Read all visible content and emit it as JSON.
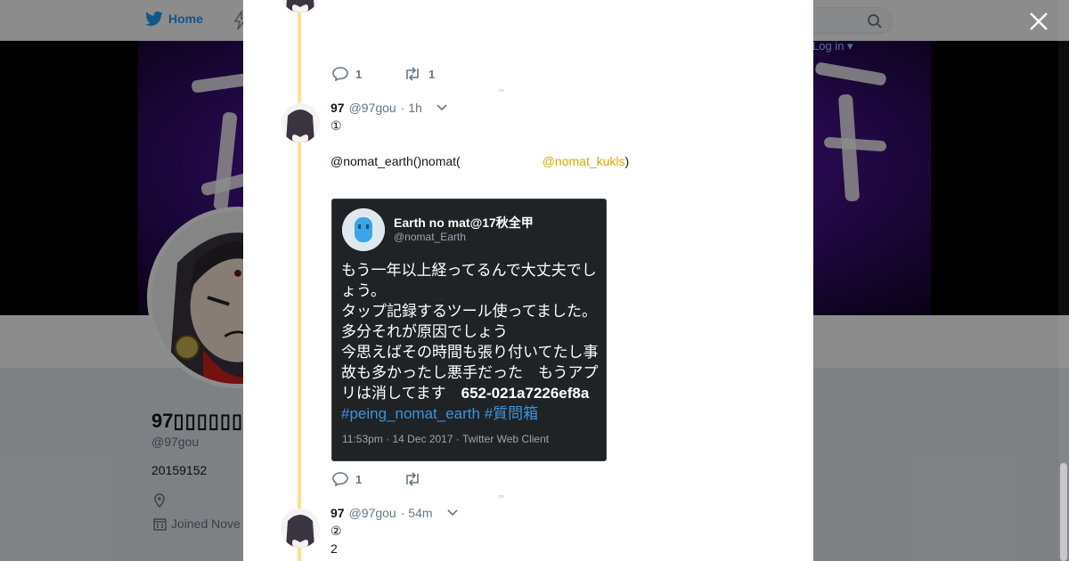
{
  "nav": {
    "home_label": "Home",
    "login_label": "Log in ▾"
  },
  "profile": {
    "display_name": "97",
    "handle": "@97gou",
    "bio": "20159152",
    "joined_label": "Joined Nove"
  },
  "tweets": [
    {
      "reply_count": "1",
      "retweet_count": "1"
    },
    {
      "name": "97",
      "handle": "@97gou",
      "time": "· 1h",
      "line1": "①",
      "line2_prefix": "@nomat_earth()nomat(",
      "line2_mention": "@nomat_kukls",
      "line2_suffix": ")",
      "reply_count": "1",
      "retweet_count": ""
    },
    {
      "name": "97",
      "handle": "@97gou",
      "time": "· 54m",
      "line1": "②",
      "line2": "2"
    }
  ],
  "embed": {
    "name": "Earth no mat@17秋全甲",
    "handle": "@nomat_Earth",
    "text_lines": [
      "もう一年以上経ってるんで大丈夫でしょう。",
      "タップ記録するツール使ってました。多分それが原因でしょう",
      "今思えばその時間も張り付いてたし事故も多かったし悪手だった　もうアプリは消してます　"
    ],
    "code": "652-021a7226ef8a",
    "hashtag1": "#peing_nomat_earth",
    "hashtag2": "#質問箱",
    "meta": "11:53pm · 14 Dec 2017 · Twitter Web Client"
  },
  "colors": {
    "accent": "#1da1f2",
    "mention": "#e0a800",
    "thread_line": "#ffe08a",
    "embed_bg": "#1f2326"
  }
}
